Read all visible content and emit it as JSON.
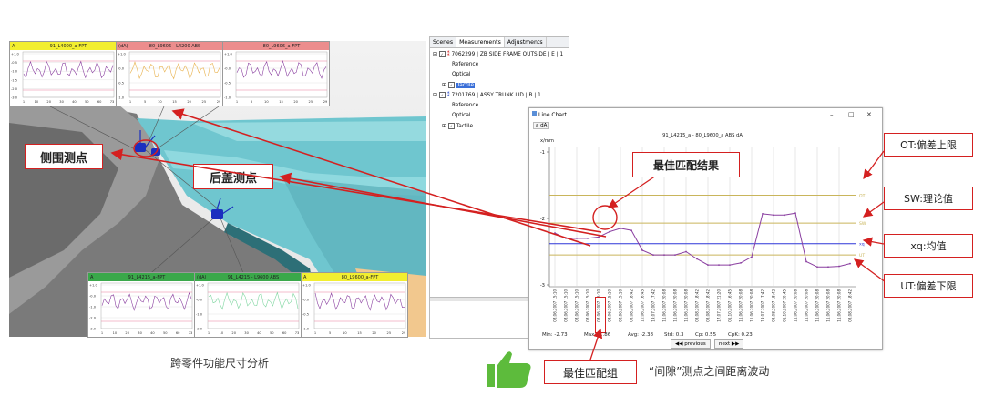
{
  "scene": {
    "label_side": "侧围测点",
    "label_rear": "后盖测点",
    "caption": "跨零件功能尺寸分析",
    "mini_charts": [
      {
        "a": "A",
        "title": "91_L4000_a-FPT",
        "header_color": "#f2ee30",
        "line_color": "#8a3fa0",
        "ticks": [
          "1",
          "10",
          "20",
          "30",
          "40",
          "50",
          "60",
          "73"
        ],
        "ylabels": [
          "+1.0",
          "-0.5",
          "-1.0",
          "-1.5",
          "-2.0",
          "-3.0"
        ]
      },
      {
        "a": "(dA)",
        "title": "80_L9606 - L4200 ABS",
        "header_color": "#ec8d8d",
        "line_color": "#e8b04a",
        "ticks": [
          "1",
          "5",
          "10",
          "15",
          "20",
          "25",
          "29"
        ],
        "ylabels": [
          "+1.0",
          "-0.0",
          "-0.5",
          "-1.0"
        ]
      },
      {
        "a": "",
        "title": "80_L9606_a-FPT",
        "header_color": "#ec8d8d",
        "line_color": "#8a3fa0",
        "ticks": [
          "1",
          "5",
          "10",
          "15",
          "20",
          "25",
          "29"
        ],
        "ylabels": [
          "+1.0",
          "-0.0",
          "-0.5",
          "-1.0"
        ]
      },
      {
        "a": "A",
        "title": "91_L4215_a-FPT",
        "header_color": "#3aa84a",
        "line_color": "#8a3fa0",
        "ticks": [
          "1",
          "10",
          "20",
          "30",
          "40",
          "50",
          "60",
          "73"
        ],
        "ylabels": [
          "+1.0",
          "-0.0",
          "-1.0",
          "-2.0",
          "-3.0"
        ]
      },
      {
        "a": "(dA)",
        "title": "91_L4215 - L9600 ABS",
        "header_color": "#3aa84a",
        "line_color": "#7fd6a0",
        "ticks": [
          "1",
          "10",
          "20",
          "30",
          "40",
          "50",
          "60",
          "73"
        ],
        "ylabels": [
          "+1.0",
          "-0.0",
          "-1.0",
          "-2.0"
        ]
      },
      {
        "a": "A",
        "title": "80_L9600_a-FPT",
        "header_color": "#f2ee30",
        "line_color": "#8a3fa0",
        "ticks": [
          "1",
          "5",
          "10",
          "15",
          "20",
          "25",
          "29"
        ],
        "ylabels": [
          "+1.0",
          "-0.0",
          "-0.5",
          "-1.0"
        ]
      }
    ]
  },
  "tree": {
    "tabs": [
      "Scenes",
      "Measurements",
      "Adjustments"
    ],
    "items": [
      "7062299 | ZB SIDE FRAME OUTSIDE | E | 1",
      "Reference",
      "Optical",
      "Tactile",
      "7201769 | ASSY TRUNK LID | B | 1",
      "Reference",
      "Optical",
      "Tactile"
    ]
  },
  "window": {
    "title": "Line Chart",
    "tab": "a dA",
    "chart_title": "91_L4215_a - 80_L9600_a ABS dA",
    "stats": {
      "min": "Min: -2.73",
      "max": "Max: -1.86",
      "avg": "Avg: -2.38",
      "std": "Std: 0.3",
      "cp": "Cp: 0.55",
      "cpk": "CpK: 0.23"
    },
    "prev": "previous",
    "next": "next"
  },
  "chart_data": {
    "type": "line",
    "title": "91_L4215_a - 80_L9600_a ABS dA",
    "ylabel": "x/mm",
    "ylim": [
      -3.0,
      -1.0
    ],
    "yticks": [
      -3,
      -2,
      -1
    ],
    "x": [
      "08.06.2007 15:10",
      "08.06.2007 15:10",
      "08.06.2007 15:10",
      "08.06.2007 15:10",
      "08.06.2007 15:10",
      "08.06.2007 15:10",
      "08.06.2007 15:10",
      "03.08.2007 18:42",
      "10.06.2007 16:45",
      "19.07.2007 17:42",
      "11.06.2007 20:08",
      "11.06.2007 20:08",
      "11.06.2007 20:08",
      "03.08.2007 18:42",
      "03.08.2007 18:42",
      "17.07.2007 21:20",
      "01.10.2007 16:45",
      "11.06.2007 20:08",
      "11.06.2007 20:08",
      "19.07.2007 17:42",
      "03.08.2007 18:42",
      "01.10.2007 20:45",
      "11.06.2007 20:08",
      "11.06.2007 20:08",
      "11.06.2007 20:08",
      "11.06.2007 20:08",
      "11.06.2007 20:08",
      "03.08.2007 18:42"
    ],
    "series": [
      {
        "values": [
          -2.22,
          -2.3,
          -2.3,
          -2.3,
          -2.28,
          -2.2,
          -2.15,
          -2.18,
          -2.48,
          -2.55,
          -2.55,
          -2.55,
          -2.5,
          -2.61,
          -2.7,
          -2.7,
          -2.7,
          -2.67,
          -2.58,
          -1.93,
          -1.95,
          -1.95,
          -1.92,
          -2.65,
          -2.73,
          -2.73,
          -2.72,
          -2.68
        ],
        "color": "#8a3fa0"
      }
    ],
    "reference_lines": [
      {
        "label": "OT",
        "value": -1.65,
        "color": "#c9b55b"
      },
      {
        "label": "SW",
        "value": -2.07,
        "color": "#c9b55b"
      },
      {
        "label": "xq",
        "value": -2.38,
        "color": "#2f36d8"
      },
      {
        "label": "UT",
        "value": -2.55,
        "color": "#c9b55b"
      }
    ]
  },
  "annotations": {
    "best_fit_result": "最佳匹配结果",
    "ot": "OT:偏差上限",
    "sw": "SW:理论值",
    "xq": "xq:均值",
    "ut": "UT:偏差下限",
    "best_group": "最佳匹配组",
    "gap_caption": "“间隙”测点之间距离波动"
  },
  "colors": {
    "accent": "#d42020",
    "thumb": "#5dbb3c"
  }
}
